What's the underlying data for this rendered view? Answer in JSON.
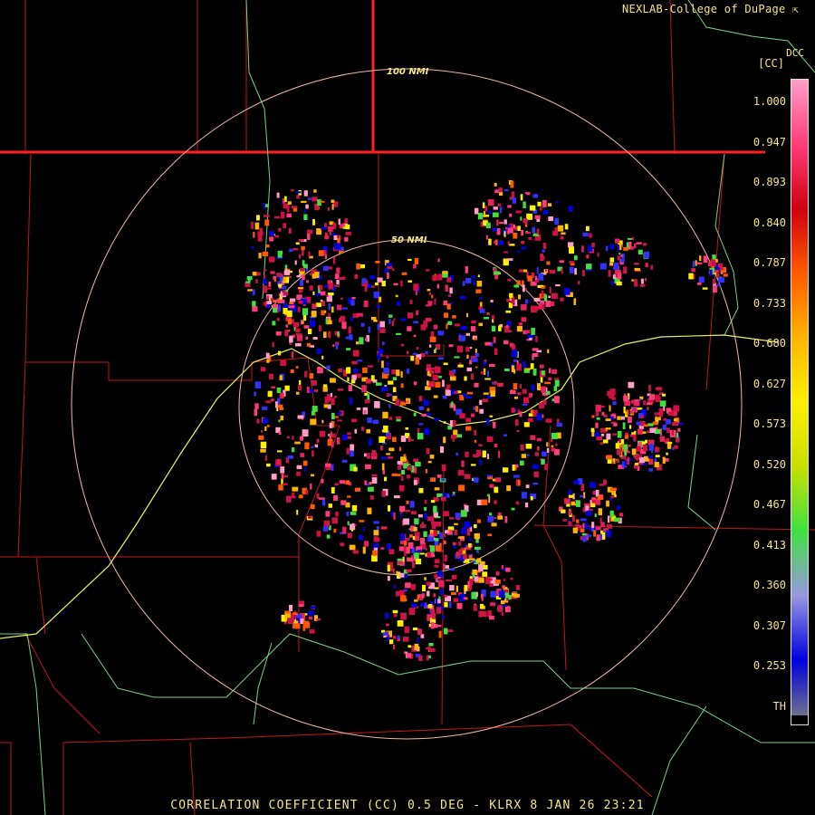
{
  "header": {
    "credit": "NEXLAB-College of DuPage",
    "credit_icon": "arrow-icon",
    "site_label": "DCC"
  },
  "rings": {
    "outer_label": "100 NMI",
    "inner_label": "50 NMI"
  },
  "legend": {
    "unit": "[CC]",
    "ticks": [
      "1.000",
      "0.947",
      "0.893",
      "0.840",
      "0.787",
      "0.733",
      "0.680",
      "0.627",
      "0.573",
      "0.520",
      "0.467",
      "0.413",
      "0.360",
      "0.307",
      "0.253",
      "TH"
    ],
    "colors": [
      "#ff9ec8",
      "#ff3d7a",
      "#d00010",
      "#ff5a00",
      "#ffb400",
      "#fff000",
      "#c8e000",
      "#40e040",
      "#9898e0",
      "#0000e0",
      "#808080"
    ]
  },
  "footer": {
    "caption": "CORRELATION COEFFICIENT (CC) 0.5 DEG - KLRX 8 JAN 26 23:21"
  },
  "colors": {
    "label": "#f5e58a",
    "border_state": "#ff2020",
    "border_county": "#c01818",
    "rings": "#f0b8a0",
    "roads": "#7dd080",
    "highway": "#e8f060"
  }
}
